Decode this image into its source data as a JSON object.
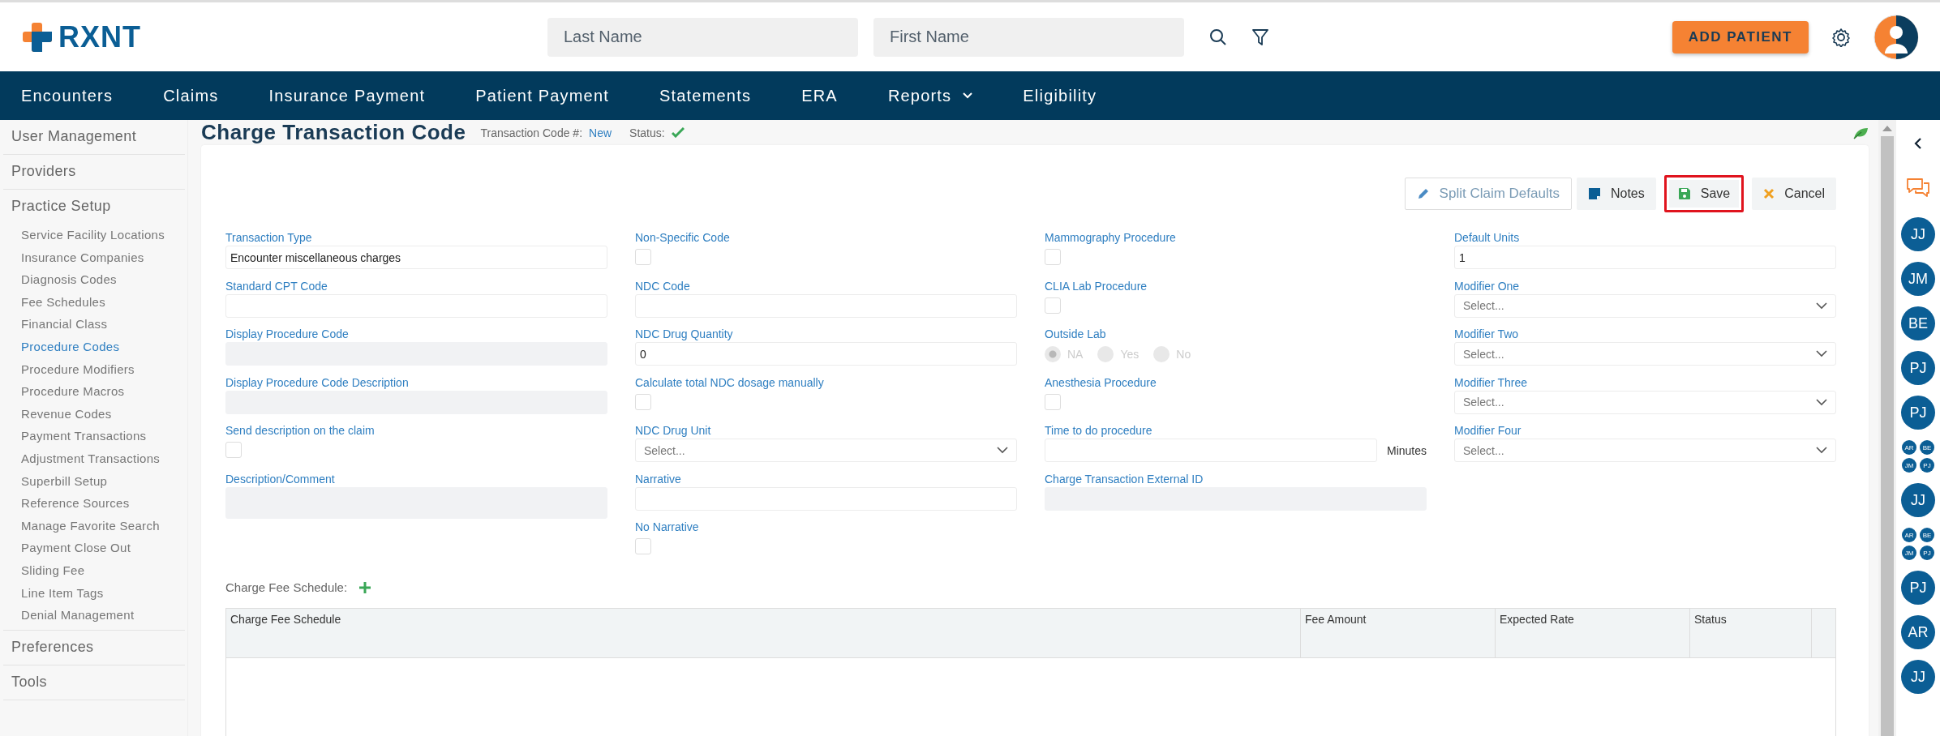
{
  "header": {
    "logo": "RXNT",
    "search_fields": [
      {
        "placeholder": "Last Name"
      },
      {
        "placeholder": "First Name"
      }
    ],
    "add_button": "ADD PATIENT"
  },
  "nav": [
    {
      "label": "Encounters",
      "dropdown": false
    },
    {
      "label": "Claims",
      "dropdown": false
    },
    {
      "label": "Insurance Payment",
      "dropdown": false
    },
    {
      "label": "Patient Payment",
      "dropdown": false
    },
    {
      "label": "Statements",
      "dropdown": false
    },
    {
      "label": "ERA",
      "dropdown": false
    },
    {
      "label": "Reports",
      "dropdown": true
    },
    {
      "label": "Eligibility",
      "dropdown": false
    }
  ],
  "sidebar": {
    "items": [
      {
        "label": "User Management",
        "expanded": false
      },
      {
        "label": "Providers",
        "expanded": false
      },
      {
        "label": "Practice Setup",
        "expanded": true,
        "children": [
          {
            "label": "Service Facility Locations",
            "selected": false
          },
          {
            "label": "Insurance Companies",
            "selected": false
          },
          {
            "label": "Diagnosis Codes",
            "selected": false
          },
          {
            "label": "Fee Schedules",
            "selected": false
          },
          {
            "label": "Financial Class",
            "selected": false
          },
          {
            "label": "Procedure Codes",
            "selected": true
          },
          {
            "label": "Procedure Modifiers",
            "selected": false
          },
          {
            "label": "Procedure Macros",
            "selected": false
          },
          {
            "label": "Revenue Codes",
            "selected": false
          },
          {
            "label": "Payment Transactions",
            "selected": false
          },
          {
            "label": "Adjustment Transactions",
            "selected": false
          },
          {
            "label": "Superbill Setup",
            "selected": false
          },
          {
            "label": "Reference Sources",
            "selected": false
          },
          {
            "label": "Manage Favorite Search",
            "selected": false
          },
          {
            "label": "Payment Close Out",
            "selected": false
          },
          {
            "label": "Sliding Fee",
            "selected": false
          },
          {
            "label": "Line Item Tags",
            "selected": false
          },
          {
            "label": "Denial Management",
            "selected": false
          }
        ]
      },
      {
        "label": "Preferences",
        "expanded": false
      },
      {
        "label": "Tools",
        "expanded": false
      }
    ]
  },
  "page": {
    "title": "Charge Transaction Code",
    "code_label": "Transaction Code #:",
    "code_value": "New",
    "status_label": "Status:",
    "status_ok": true
  },
  "actions": [
    {
      "kind": "split",
      "label": "Split Claim Defaults",
      "highlighted": false
    },
    {
      "kind": "notes",
      "label": "Notes",
      "highlighted": false
    },
    {
      "kind": "save",
      "label": "Save",
      "highlighted": true
    },
    {
      "kind": "cancel",
      "label": "Cancel",
      "highlighted": false
    }
  ],
  "form": {
    "columns": [
      [
        {
          "label": "Transaction Type",
          "kind": "text",
          "value": "Encounter miscellaneous charges"
        },
        {
          "label": "Standard CPT Code",
          "kind": "text"
        },
        {
          "label": "Display Procedure Code",
          "kind": "readonly"
        },
        {
          "label": "Display Procedure Code Description",
          "kind": "readonly"
        },
        {
          "label": "Send description on the claim",
          "kind": "checkbox",
          "checked": false
        },
        {
          "label": "Description/Comment",
          "kind": "textarea"
        }
      ],
      [
        {
          "label": "Non-Specific Code",
          "kind": "checkbox",
          "checked": false
        },
        {
          "label": "NDC Code",
          "kind": "text"
        },
        {
          "label": "NDC Drug Quantity",
          "kind": "text",
          "value": "0"
        },
        {
          "label": "Calculate total NDC dosage manually",
          "kind": "checkbox",
          "checked": false
        },
        {
          "label": "NDC Drug Unit",
          "kind": "select",
          "placeholder": "Select..."
        },
        {
          "label": "Narrative",
          "kind": "text"
        },
        {
          "label": "No Narrative",
          "kind": "checkbox",
          "checked": false
        }
      ],
      [
        {
          "label": "Mammography Procedure",
          "kind": "checkbox",
          "checked": false
        },
        {
          "label": "CLIA Lab Procedure",
          "kind": "checkbox",
          "checked": false
        },
        {
          "label": "Outside Lab",
          "kind": "radio",
          "disabled": true,
          "options": [
            {
              "label": "NA",
              "selected": true
            },
            {
              "label": "Yes",
              "selected": false
            },
            {
              "label": "No",
              "selected": false
            }
          ]
        },
        {
          "label": "Anesthesia Procedure",
          "kind": "checkbox",
          "checked": false
        },
        {
          "label": "Time to do procedure",
          "kind": "text",
          "suffix": "Minutes"
        },
        {
          "label": "Charge Transaction External ID",
          "kind": "readonly"
        }
      ],
      [
        {
          "label": "Default Units",
          "kind": "text",
          "value": "1"
        },
        {
          "label": "Modifier One",
          "kind": "select",
          "placeholder": "Select..."
        },
        {
          "label": "Modifier Two",
          "kind": "select",
          "placeholder": "Select..."
        },
        {
          "label": "Modifier Three",
          "kind": "select",
          "placeholder": "Select..."
        },
        {
          "label": "Modifier Four",
          "kind": "select",
          "placeholder": "Select..."
        }
      ]
    ]
  },
  "fee_schedule": {
    "label": "Charge Fee Schedule:",
    "columns": [
      "Charge Fee Schedule",
      "Fee Amount",
      "Expected Rate",
      "Status"
    ]
  },
  "rail": [
    {
      "kind": "single",
      "initials": [
        "JJ"
      ]
    },
    {
      "kind": "single",
      "initials": [
        "JM"
      ]
    },
    {
      "kind": "single",
      "initials": [
        "BE"
      ]
    },
    {
      "kind": "single",
      "initials": [
        "PJ"
      ]
    },
    {
      "kind": "single",
      "initials": [
        "PJ"
      ]
    },
    {
      "kind": "group",
      "initials": [
        "AR",
        "BE",
        "JM",
        "PJ"
      ]
    },
    {
      "kind": "single",
      "initials": [
        "JJ"
      ]
    },
    {
      "kind": "group",
      "initials": [
        "AR",
        "BE",
        "JM",
        "PJ"
      ]
    },
    {
      "kind": "single",
      "initials": [
        "PJ"
      ]
    },
    {
      "kind": "single",
      "initials": [
        "AR"
      ]
    },
    {
      "kind": "single",
      "initials": [
        "JJ"
      ]
    }
  ]
}
